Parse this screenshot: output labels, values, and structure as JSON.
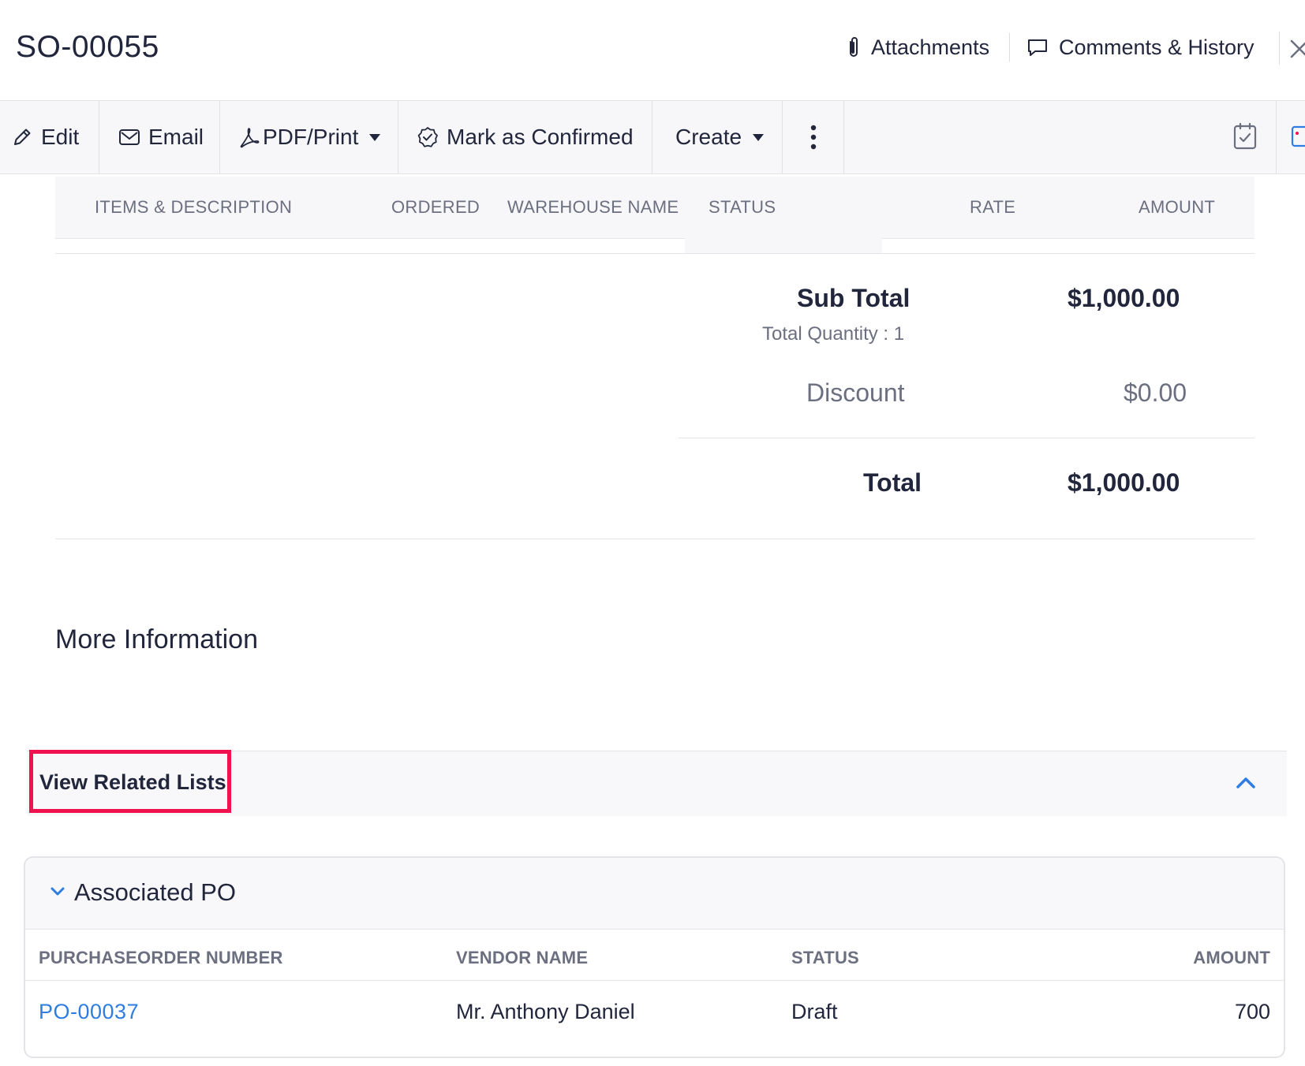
{
  "header": {
    "title": "SO-00055",
    "attachments_label": "Attachments",
    "comments_label": "Comments & History"
  },
  "toolbar": {
    "edit_label": "Edit",
    "email_label": "Email",
    "pdf_label": "PDF/Print",
    "confirm_label": "Mark as Confirmed",
    "create_label": "Create"
  },
  "items_table": {
    "columns": [
      "ITEMS & DESCRIPTION",
      "ORDERED",
      "WAREHOUSE NAME",
      "STATUS",
      "RATE",
      "AMOUNT"
    ]
  },
  "totals": {
    "subtotal_label": "Sub Total",
    "subtotal_value": "$1,000.00",
    "total_quantity": "Total Quantity : 1",
    "discount_label": "Discount",
    "discount_value": "$0.00",
    "total_label": "Total",
    "total_value": "$1,000.00"
  },
  "more_info": {
    "title": "More Information"
  },
  "related": {
    "label": "View Related Lists"
  },
  "associated_po": {
    "title": "Associated PO",
    "columns": [
      "PURCHASEORDER NUMBER",
      "VENDOR NAME",
      "STATUS",
      "AMOUNT"
    ],
    "rows": [
      {
        "number": "PO-00037",
        "vendor": "Mr. Anthony Daniel",
        "status": "Draft",
        "amount": "700"
      }
    ]
  },
  "colors": {
    "accent": "#2f7de1",
    "highlight": "#f0124e",
    "text": "#21263c",
    "muted": "#6b6f80"
  }
}
